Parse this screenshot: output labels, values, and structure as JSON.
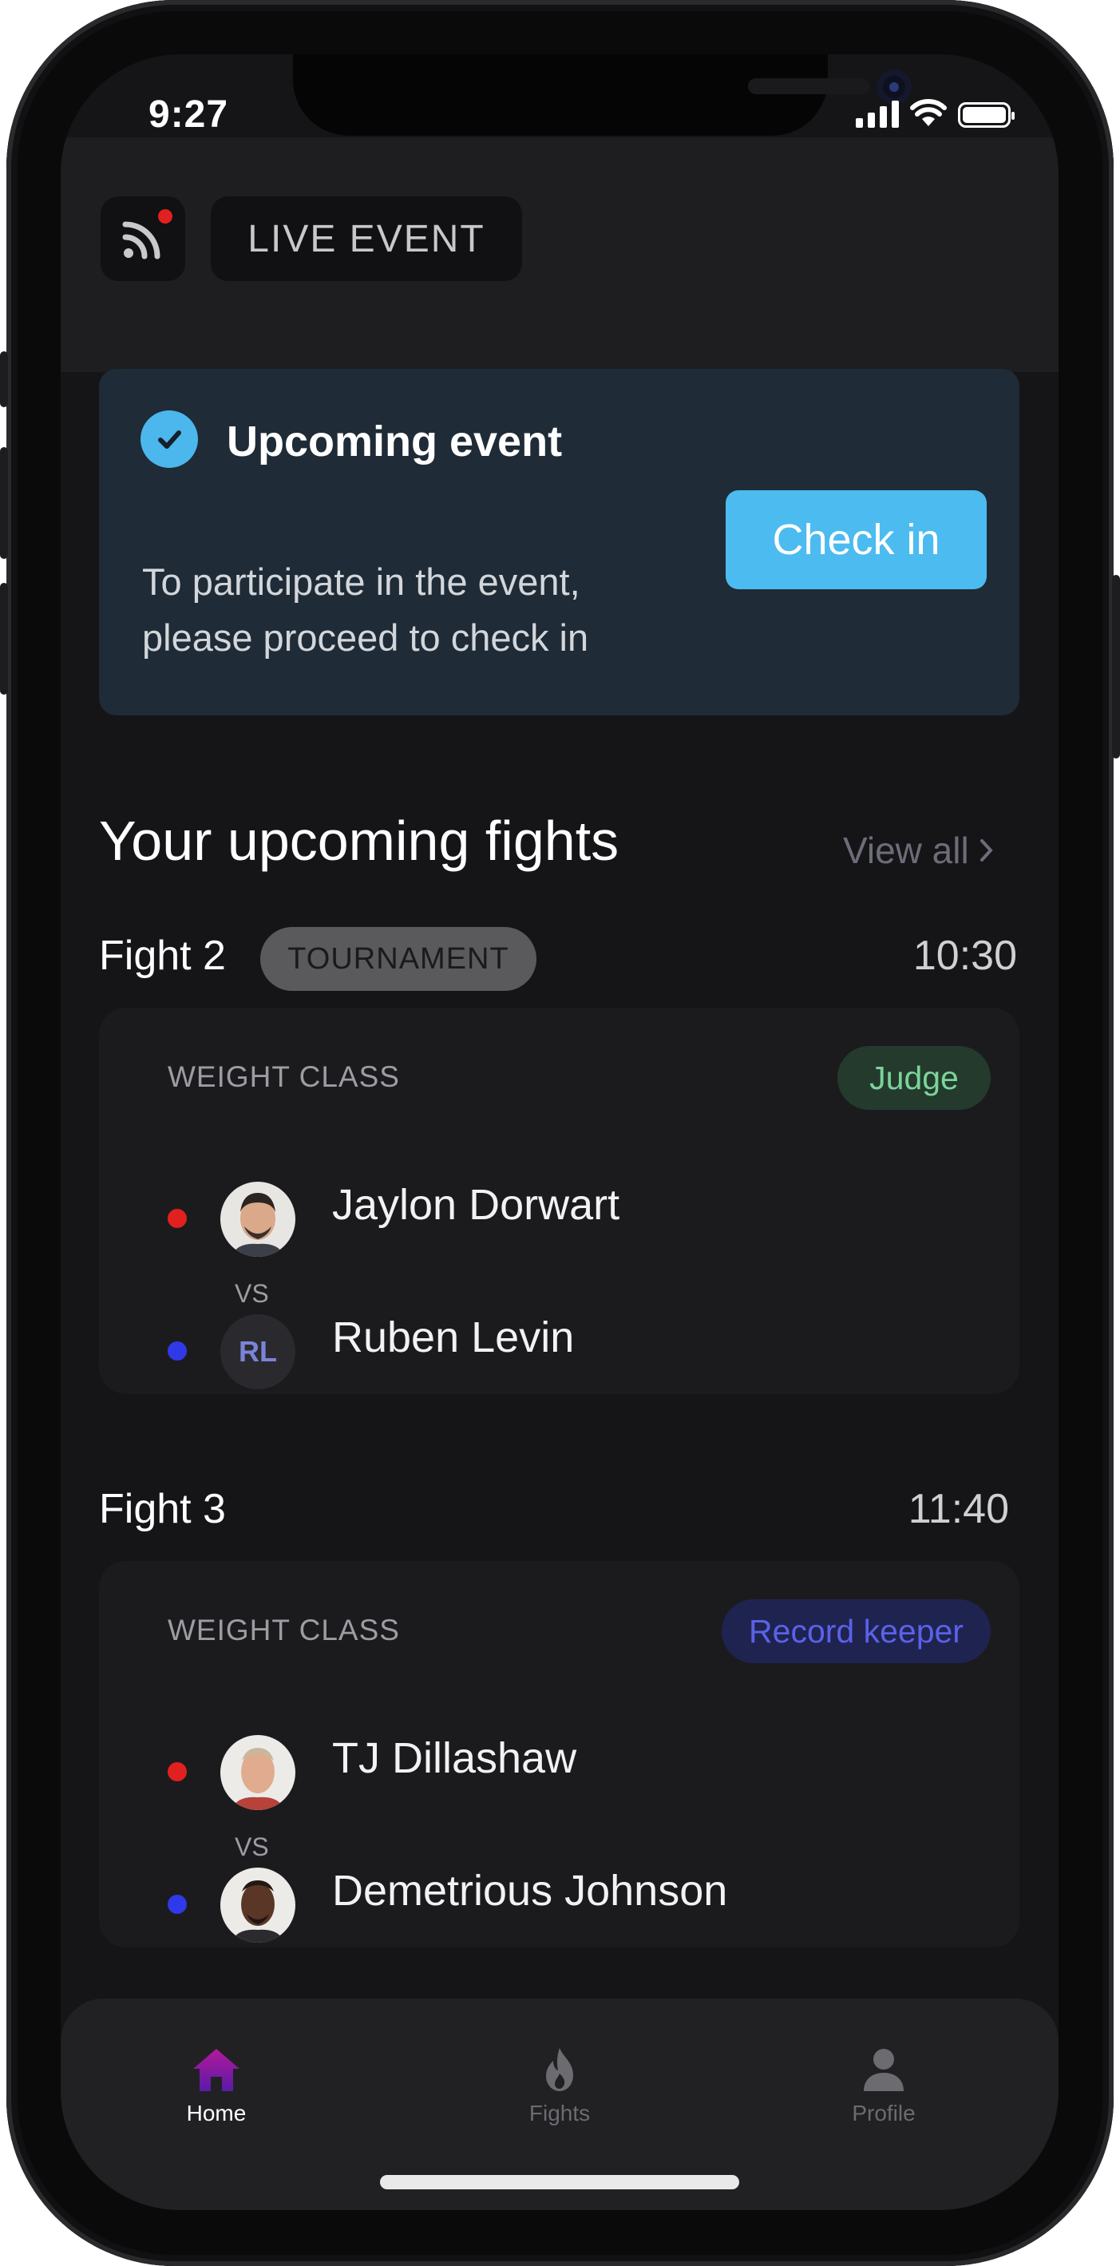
{
  "status_bar": {
    "time": "9:27"
  },
  "header": {
    "live_icon": "rss-feed-icon",
    "live_label": "LIVE EVENT"
  },
  "upcoming_event": {
    "icon": "check-circle-icon",
    "title": "Upcoming event",
    "description": "To participate in the event, please proceed to check in",
    "button_label": "Check in"
  },
  "fights_section": {
    "title": "Your upcoming fights",
    "view_all": "View all"
  },
  "fights": [
    {
      "label": "Fight 2",
      "badge": "TOURNAMENT",
      "time": "10:30",
      "weight_class": "WEIGHT CLASS",
      "role": "Judge",
      "red_fighter": "Jaylon Dorwart",
      "vs": "VS",
      "blue_fighter": "Ruben Levin",
      "blue_initials": "RL"
    },
    {
      "label": "Fight 3",
      "time": "11:40",
      "weight_class": "WEIGHT CLASS",
      "role": "Record keeper",
      "red_fighter": "TJ Dillashaw",
      "vs": "VS",
      "blue_fighter": "Demetrious Johnson"
    }
  ],
  "tabs": [
    {
      "label": "Home",
      "icon": "home-icon",
      "active": true
    },
    {
      "label": "Fights",
      "icon": "fire-icon",
      "active": false
    },
    {
      "label": "Profile",
      "icon": "person-icon",
      "active": false
    }
  ],
  "colors": {
    "accent": "#4cbbf0",
    "red_corner": "#e0211f",
    "blue_corner": "#2f39e8",
    "judge": "#7bd49a",
    "record_keeper": "#5a62e8"
  }
}
